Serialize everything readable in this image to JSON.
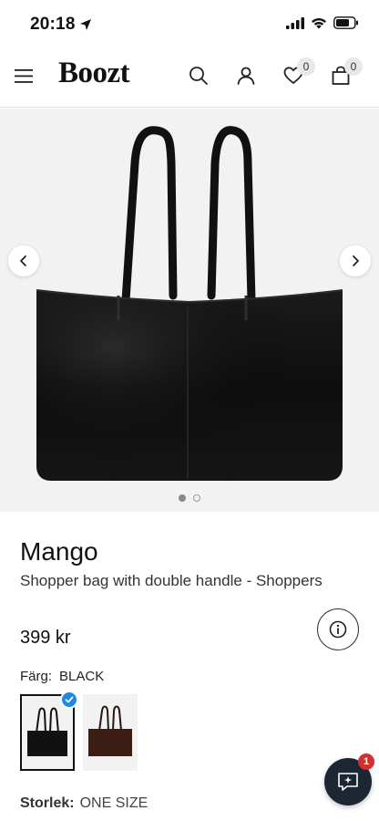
{
  "status_bar": {
    "time": "20:18"
  },
  "header": {
    "logo": "Boozt",
    "wishlist_count": "0",
    "cart_count": "0"
  },
  "gallery": {
    "image_count": 2,
    "active_index": 0
  },
  "product": {
    "brand": "Mango",
    "name": "Shopper bag with double handle - Shoppers",
    "price": "399 kr",
    "color_label": "Färg:",
    "color_value": "BLACK",
    "color_options": [
      "black",
      "brown"
    ],
    "selected_color": "black",
    "size_label": "Storlek:",
    "size_value": "ONE SIZE"
  },
  "chat": {
    "badge_count": "1"
  },
  "colors": {
    "accent_blue": "#1e88e5",
    "chat_bg": "#1d2633",
    "badge_red": "#d32f2f"
  }
}
